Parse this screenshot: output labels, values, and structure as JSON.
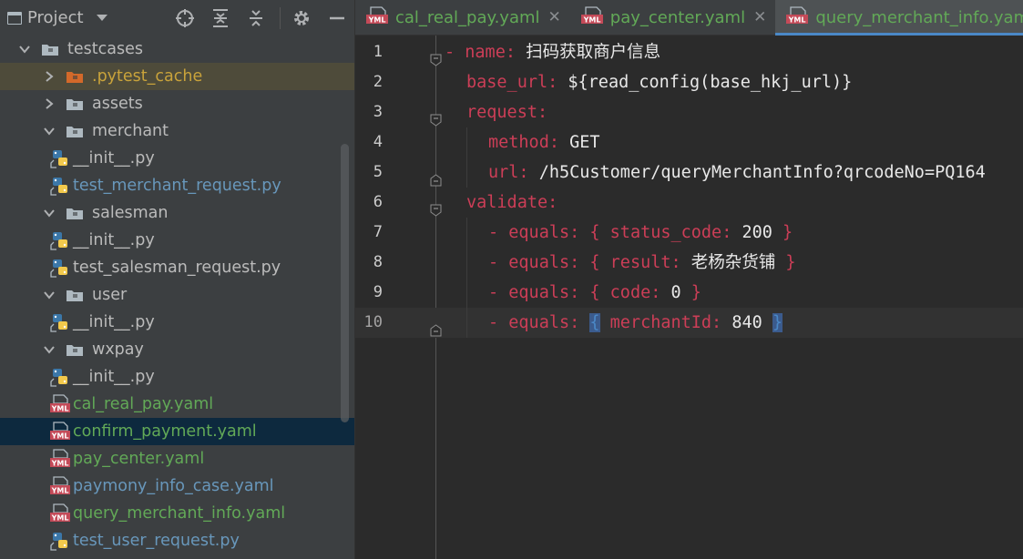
{
  "project_panel": {
    "title": "Project",
    "icons": [
      "locate-icon",
      "expand-all-icon",
      "collapse-all-icon",
      "settings-icon",
      "hide-icon"
    ],
    "tree": [
      {
        "label": "testcases",
        "type": "folder",
        "depth": 0,
        "expanded": true,
        "color": "default"
      },
      {
        "label": ".pytest_cache",
        "type": "folder-excluded",
        "depth": 1,
        "expanded": false,
        "color": "orange"
      },
      {
        "label": "assets",
        "type": "folder",
        "depth": 1,
        "expanded": false,
        "color": "default"
      },
      {
        "label": "merchant",
        "type": "folder",
        "depth": 1,
        "expanded": true,
        "color": "default"
      },
      {
        "label": "__init__.py",
        "type": "python",
        "depth": 2,
        "color": "default"
      },
      {
        "label": "test_merchant_request.py",
        "type": "python",
        "depth": 2,
        "color": "blue"
      },
      {
        "label": "salesman",
        "type": "folder",
        "depth": 1,
        "expanded": true,
        "color": "default"
      },
      {
        "label": "__init__.py",
        "type": "python",
        "depth": 2,
        "color": "default"
      },
      {
        "label": "test_salesman_request.py",
        "type": "python",
        "depth": 2,
        "color": "default"
      },
      {
        "label": "user",
        "type": "folder",
        "depth": 1,
        "expanded": true,
        "color": "default"
      },
      {
        "label": "__init__.py",
        "type": "python",
        "depth": 2,
        "color": "default"
      },
      {
        "label": "wxpay",
        "type": "folder",
        "depth": 1,
        "expanded": true,
        "color": "default"
      },
      {
        "label": "__init__.py",
        "type": "python",
        "depth": 2,
        "color": "default"
      },
      {
        "label": "cal_real_pay.yaml",
        "type": "yaml",
        "depth": 2,
        "color": "green"
      },
      {
        "label": "confirm_payment.yaml",
        "type": "yaml",
        "depth": 2,
        "color": "green",
        "selected": true
      },
      {
        "label": "pay_center.yaml",
        "type": "yaml",
        "depth": 2,
        "color": "green"
      },
      {
        "label": "paymony_info_case.yaml",
        "type": "yaml",
        "depth": 2,
        "color": "blue"
      },
      {
        "label": "query_merchant_info.yaml",
        "type": "yaml",
        "depth": 2,
        "color": "green"
      },
      {
        "label": "test_user_request.py",
        "type": "python",
        "depth": 2,
        "color": "blue"
      }
    ]
  },
  "tabs": [
    {
      "label": "cal_real_pay.yaml",
      "active": false,
      "color": "green"
    },
    {
      "label": "pay_center.yaml",
      "active": false,
      "color": "green"
    },
    {
      "label": "query_merchant_info.yaml",
      "active": true,
      "color": "green"
    }
  ],
  "editor": {
    "current_line": 10,
    "lines": [
      {
        "n": "1",
        "parts": [
          [
            "dash-top",
            "- "
          ],
          [
            "k",
            "name: "
          ],
          [
            "cn",
            "扫码获取商户信息"
          ]
        ],
        "indent": 0,
        "fold": "open"
      },
      {
        "n": "2",
        "parts": [
          [
            "k",
            "base_url: "
          ],
          [
            "v",
            "${read_config(base_hkj_url)}"
          ]
        ],
        "indent": 0
      },
      {
        "n": "3",
        "parts": [
          [
            "k",
            "request:"
          ]
        ],
        "indent": 0,
        "fold": "open"
      },
      {
        "n": "4",
        "parts": [
          [
            "k",
            "method: "
          ],
          [
            "v",
            "GET"
          ]
        ],
        "indent": 1
      },
      {
        "n": "5",
        "parts": [
          [
            "k",
            "url: "
          ],
          [
            "v",
            "/h5Customer/queryMerchantInfo?qrcodeNo=PQ164"
          ]
        ],
        "indent": 1,
        "fold": "close"
      },
      {
        "n": "6",
        "parts": [
          [
            "k",
            "validate:"
          ]
        ],
        "indent": 0,
        "fold": "open"
      },
      {
        "n": "7",
        "parts": [
          [
            "k",
            "- equals: "
          ],
          [
            "brace",
            "{ "
          ],
          [
            "k",
            "status_code: "
          ],
          [
            "num",
            "200"
          ],
          [
            "brace",
            " }"
          ]
        ],
        "indent": 1
      },
      {
        "n": "8",
        "parts": [
          [
            "k",
            "- equals: "
          ],
          [
            "brace",
            "{ "
          ],
          [
            "k",
            "result: "
          ],
          [
            "cn",
            "老杨杂货铺"
          ],
          [
            "brace",
            " }"
          ]
        ],
        "indent": 1
      },
      {
        "n": "9",
        "parts": [
          [
            "k",
            "- equals: "
          ],
          [
            "brace",
            "{ "
          ],
          [
            "k",
            "code: "
          ],
          [
            "num",
            "0"
          ],
          [
            "brace",
            " }"
          ]
        ],
        "indent": 1
      },
      {
        "n": "10",
        "parts": [
          [
            "k",
            "- equals: "
          ],
          [
            "bmatch",
            "{"
          ],
          [
            "v",
            " "
          ],
          [
            "k",
            "merchantId: "
          ],
          [
            "num",
            "840"
          ],
          [
            "v",
            " "
          ],
          [
            "bmatch",
            "}"
          ]
        ],
        "indent": 1,
        "fold": "close"
      }
    ]
  },
  "colors": {
    "panel_bg": "#3c3f41",
    "editor_bg": "#2b2b2b",
    "key": "#cc3e57",
    "selection": "#0d293e",
    "accent": "#4a88c7"
  }
}
